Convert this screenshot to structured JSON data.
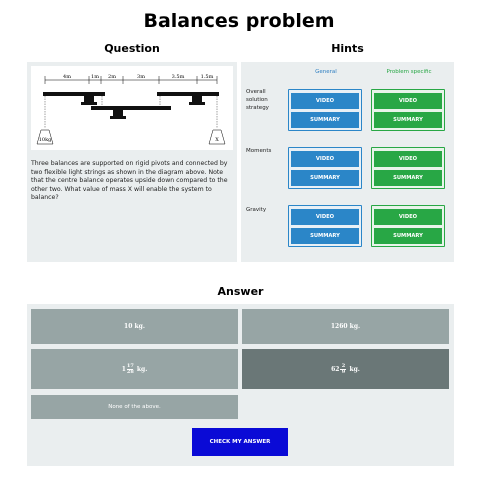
{
  "page": {
    "title": "Balances problem"
  },
  "question": {
    "heading": "Question",
    "diagram": {
      "dims": [
        "4m",
        "1m",
        "2m",
        "3m",
        "3.5m",
        "1.5m"
      ],
      "left_mass": "10kg",
      "right_mass": "X"
    },
    "text_lines": [
      "Three balances are supported on rigid pivots and connected by",
      "two flexible light strings as shown in the diagram above. Note",
      "that the centre balance operates upside down compared to the",
      "other two. What value of mass X will enable the system to",
      "balance?"
    ]
  },
  "hints": {
    "heading": "Hints",
    "col_general": "General",
    "col_specific": "Problem specific",
    "rows": [
      {
        "label_lines": [
          "Overall",
          "solution",
          "strategy"
        ],
        "video": "VIDEO",
        "summary": "SUMMARY"
      },
      {
        "label_lines": [
          "Moments"
        ],
        "video": "VIDEO",
        "summary": "SUMMARY"
      },
      {
        "label_lines": [
          "Gravity"
        ],
        "video": "VIDEO",
        "summary": "SUMMARY"
      }
    ],
    "colors": {
      "general": "#2b86c8",
      "specific": "#28a745"
    }
  },
  "answer": {
    "heading": "Answer",
    "options": {
      "a": "10 kg.",
      "b": "1260 kg.",
      "c": {
        "whole": "1",
        "num": "17",
        "den": "28",
        "unit": "kg."
      },
      "d": {
        "whole": "62",
        "num": "2",
        "den": "9",
        "unit": "kg."
      },
      "e": "None of the above."
    },
    "selected": "d",
    "check_label": "CHECK MY ANSWER",
    "colors": {
      "option": "#97a5a5",
      "selected": "#6a7777",
      "check": "#0a0ad6"
    }
  }
}
